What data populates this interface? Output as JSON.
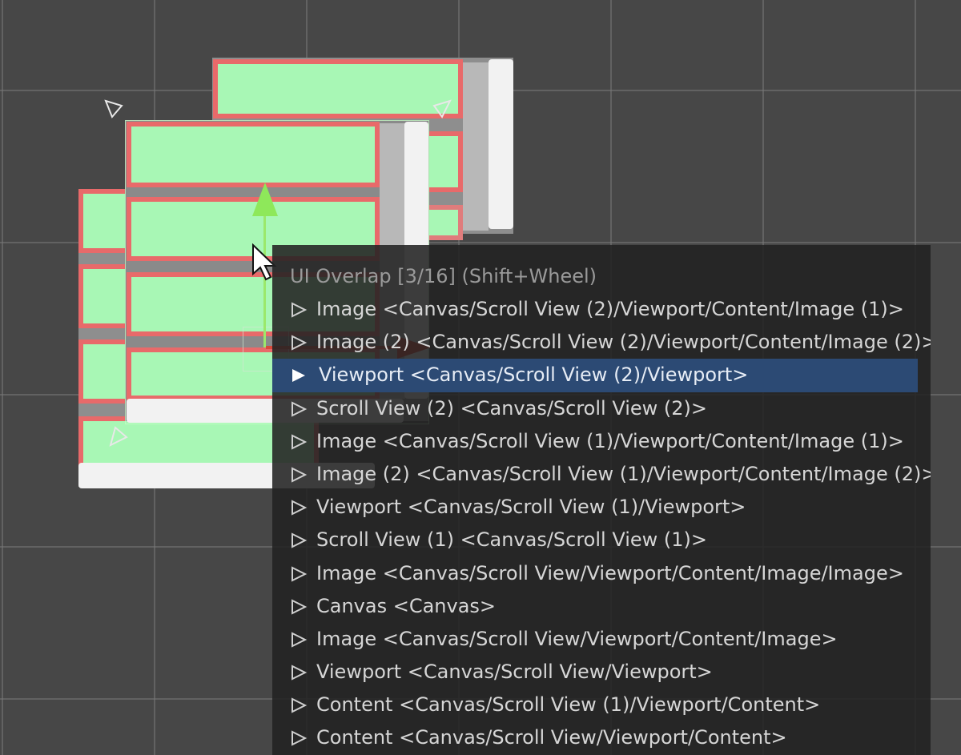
{
  "popup": {
    "title": "UI Overlap [3/16]  (Shift+Wheel)",
    "selected_index": 2,
    "items": [
      {
        "label": "Image <Canvas/Scroll View (2)/Viewport/Content/Image (1)>"
      },
      {
        "label": "Image (2) <Canvas/Scroll View (2)/Viewport/Content/Image (2)>"
      },
      {
        "label": "Viewport <Canvas/Scroll View (2)/Viewport>"
      },
      {
        "label": "Scroll View (2) <Canvas/Scroll View (2)>"
      },
      {
        "label": "Image <Canvas/Scroll View (1)/Viewport/Content/Image (1)>"
      },
      {
        "label": "Image (2) <Canvas/Scroll View (1)/Viewport/Content/Image (2)>"
      },
      {
        "label": "Viewport <Canvas/Scroll View (1)/Viewport>"
      },
      {
        "label": "Scroll View (1) <Canvas/Scroll View (1)>"
      },
      {
        "label": "Image <Canvas/Scroll View/Viewport/Content/Image/Image>"
      },
      {
        "label": "Canvas <Canvas>"
      },
      {
        "label": "Image <Canvas/Scroll View/Viewport/Content/Image>"
      },
      {
        "label": "Viewport <Canvas/Scroll View/Viewport>"
      },
      {
        "label": "Content <Canvas/Scroll View (1)/Viewport/Content>"
      },
      {
        "label": "Content <Canvas/Scroll View/Viewport/Content>"
      }
    ]
  },
  "colors": {
    "background": "#474747",
    "item_fill": "#a8f7b5",
    "item_outline": "#e86a6a",
    "selection": "#2c4a74",
    "gizmo_y": "#8ee85a",
    "gizmo_x": "#e03a2a"
  },
  "icons": {
    "row_icon": "triangle-right-outline-icon",
    "selected_row_icon": "triangle-right-filled-icon",
    "pointer": "mouse-cursor-icon"
  }
}
